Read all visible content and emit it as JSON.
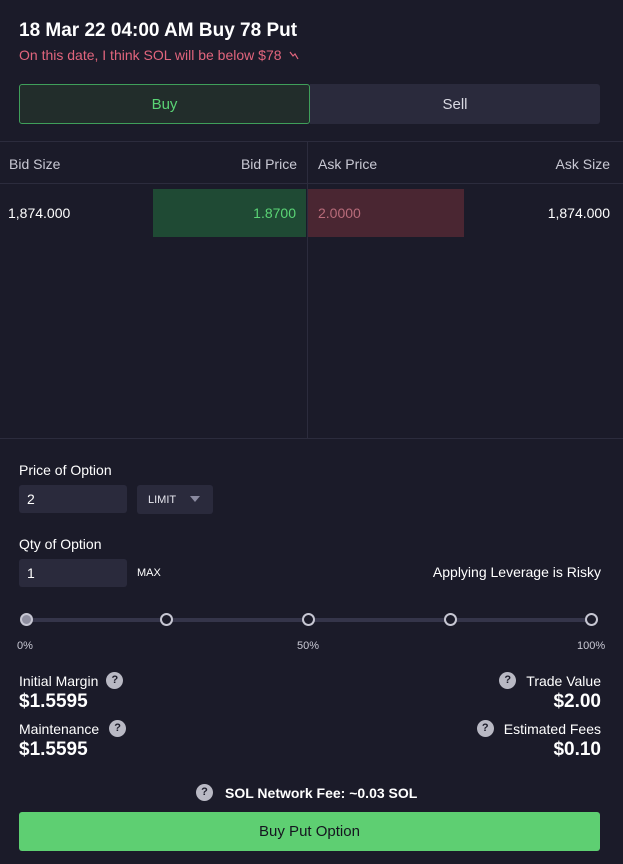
{
  "header": {
    "title": "18 Mar 22 04:00 AM Buy 78 Put",
    "subtitle": "On this date, I think SOL will be below $78",
    "trend_icon": "trend-down-icon"
  },
  "tabs": [
    {
      "label": "Buy",
      "active": true
    },
    {
      "label": "Sell",
      "active": false
    }
  ],
  "orderbook": {
    "headers": {
      "bid_size": "Bid Size",
      "bid_price": "Bid Price",
      "ask_price": "Ask Price",
      "ask_size": "Ask Size"
    },
    "rows": [
      {
        "bid_size": "1,874.000",
        "bid_price": "1.8700",
        "ask_price": "2.0000",
        "ask_size": "1,874.000"
      }
    ]
  },
  "order_form": {
    "price_label": "Price of Option",
    "price_value": "2",
    "order_type": "LIMIT",
    "qty_label": "Qty of Option",
    "qty_value": "1",
    "max_label": "MAX",
    "leverage_warning": "Applying Leverage is Risky"
  },
  "leverage_slider": {
    "value_fraction": 0,
    "tick_labels": [
      "0%",
      "50%",
      "100%"
    ]
  },
  "stats": {
    "initial_margin_label": "Initial Margin",
    "initial_margin_value": "$1.5595",
    "maintenance_label": "Maintenance",
    "maintenance_value": "$1.5595",
    "trade_value_label": "Trade Value",
    "trade_value_value": "$2.00",
    "estimated_fees_label": "Estimated Fees",
    "estimated_fees_value": "$0.10",
    "help_glyph": "?"
  },
  "network_fee": "SOL Network Fee: ~0.03 SOL",
  "cta_label": "Buy Put Option",
  "colors": {
    "background": "#1b1b29",
    "accent_green": "#5ecf72",
    "bid_green": "#5ad475",
    "ask_red": "#b86b7a",
    "subtitle_red": "#e2657d"
  }
}
